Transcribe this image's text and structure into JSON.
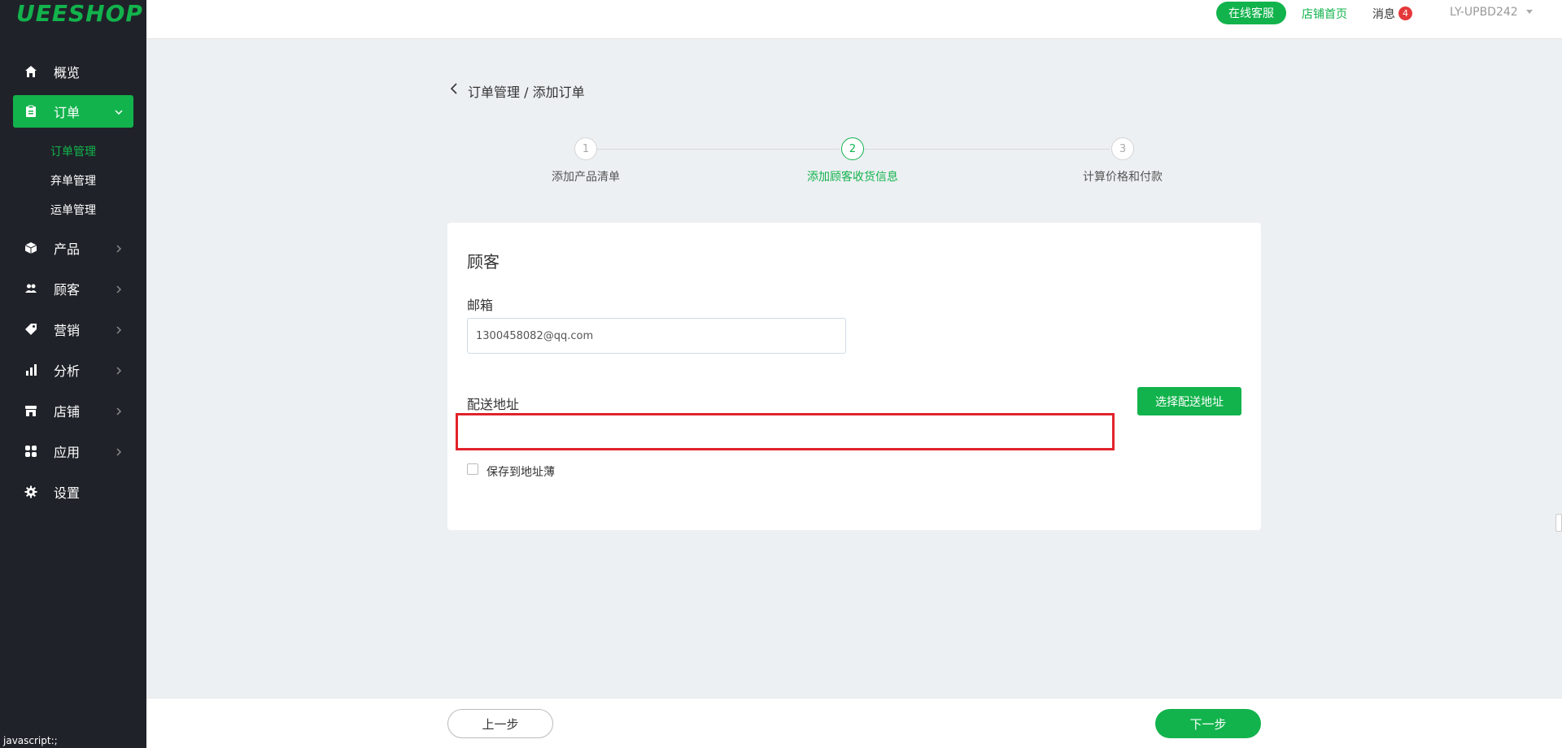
{
  "brand": {
    "logo": "UEESHOP"
  },
  "sidebar": {
    "items": [
      {
        "label": "概览",
        "icon": "home-icon"
      },
      {
        "label": "订单",
        "icon": "clipboard-icon",
        "active": true,
        "expanded": true
      },
      {
        "label": "产品",
        "icon": "box-icon"
      },
      {
        "label": "顾客",
        "icon": "users-icon"
      },
      {
        "label": "营销",
        "icon": "tag-icon"
      },
      {
        "label": "分析",
        "icon": "bar-chart-icon"
      },
      {
        "label": "店铺",
        "icon": "store-icon"
      },
      {
        "label": "应用",
        "icon": "apps-icon"
      },
      {
        "label": "设置",
        "icon": "gear-icon"
      }
    ],
    "order_sub": [
      "订单管理",
      "弃单管理",
      "运单管理"
    ]
  },
  "header": {
    "service": "在线客服",
    "home": "店铺首页",
    "messages": "消息",
    "message_count": "4",
    "user": "LY-UPBD242"
  },
  "breadcrumb": "订单管理 / 添加订单",
  "steps": [
    {
      "num": "1",
      "label": "添加产品清单"
    },
    {
      "num": "2",
      "label": "添加顾客收货信息",
      "active": true
    },
    {
      "num": "3",
      "label": "计算价格和付款"
    }
  ],
  "form": {
    "title": "顾客",
    "email_label": "邮箱",
    "email_value": "1300458082@qq.com",
    "address_label": "配送地址",
    "select_address": "选择配送地址",
    "save_to_book": "保存到地址薄"
  },
  "footer": {
    "prev": "上一步",
    "next": "下一步"
  },
  "status": "javascript:;",
  "colors": {
    "brand": "#12b34c",
    "sidebar_bg": "#1f2329",
    "highlight": "#e1232b"
  }
}
